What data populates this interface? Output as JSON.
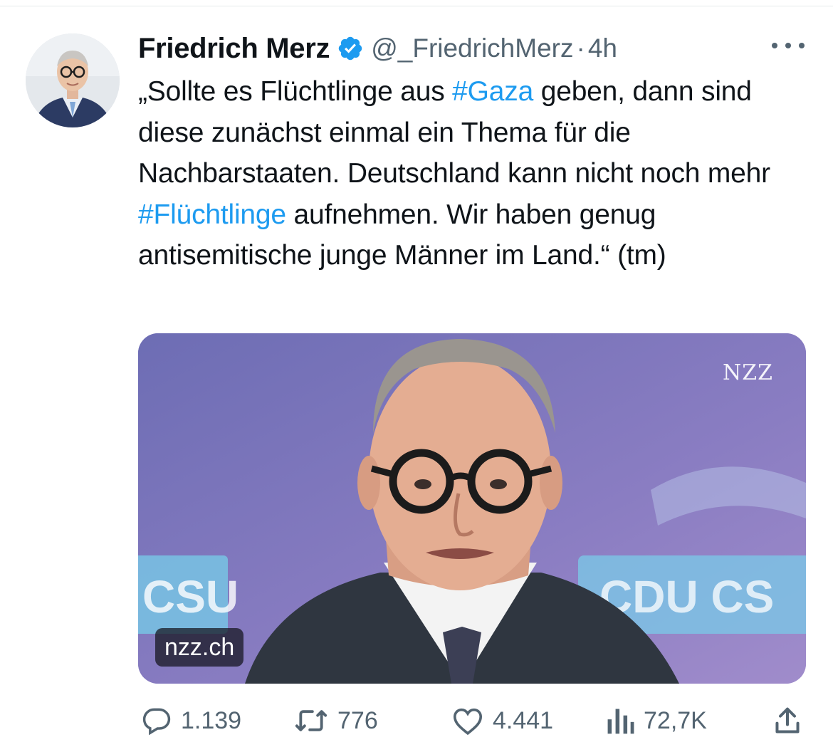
{
  "tweet": {
    "author": {
      "display_name": "Friedrich Merz",
      "handle": "@_FriedrichMerz",
      "verified": true,
      "verified_color": "#1d9bf0"
    },
    "separator": "·",
    "time": "4h",
    "text_parts": [
      {
        "text": "„Sollte es Flüchtlinge aus ",
        "type": "text"
      },
      {
        "text": "#Gaza",
        "type": "hashtag"
      },
      {
        "text": " geben, dann sind diese zunächst einmal ein Thema für die Nachbarstaaten. Deutschland kann nicht noch mehr ",
        "type": "text"
      },
      {
        "text": "#Flüchtlinge",
        "type": "hashtag"
      },
      {
        "text": " aufnehmen. Wir haben genug antisemitische junge Männer im Land.“ (tm)",
        "type": "text"
      }
    ],
    "media": {
      "watermark": "NZZ",
      "source_domain": "nzz.ch",
      "background_text_left": "CSU",
      "background_text_right": "CDU CS"
    },
    "actions": {
      "replies": "1.139",
      "retweets": "776",
      "likes": "4.441",
      "views": "72,7K"
    }
  },
  "colors": {
    "text": "#0f1419",
    "secondary": "#536471",
    "link": "#1d9bf0"
  },
  "icons": [
    "verified-badge-icon",
    "more-icon",
    "reply-icon",
    "retweet-icon",
    "like-icon",
    "views-icon",
    "share-icon"
  ]
}
